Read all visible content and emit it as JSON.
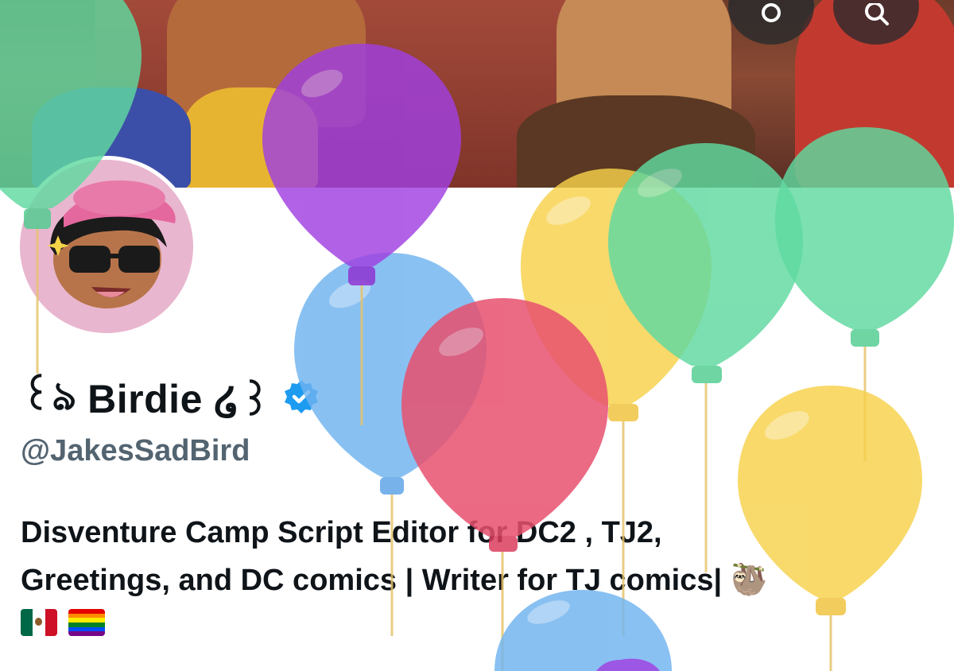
{
  "profile": {
    "display_name_prefix": "꒰ঌ",
    "display_name": "Birdie",
    "display_name_suffix": "໒꒱",
    "handle": "@JakesSadBird",
    "bio_line1": "Disventure Camp Script Editor for DC2 , TJ2,",
    "bio_line2": "Greetings, and DC comics | Writer for TJ comics|",
    "bio_emoji": "🦥",
    "flag_mexico": "🇲🇽",
    "flag_rainbow": "🏳️‍🌈",
    "verified": true
  },
  "header": {
    "icons": [
      "birdwatch-icon",
      "search-icon"
    ]
  },
  "colors": {
    "verified_blue": "#1d9bf0",
    "handle_gray": "#536471",
    "balloon_green": "#5fd9a0",
    "balloon_purple": "#a03fe0",
    "balloon_blue": "#6fb8f5",
    "balloon_red": "#e8506e",
    "balloon_yellow": "#f7d14a"
  }
}
